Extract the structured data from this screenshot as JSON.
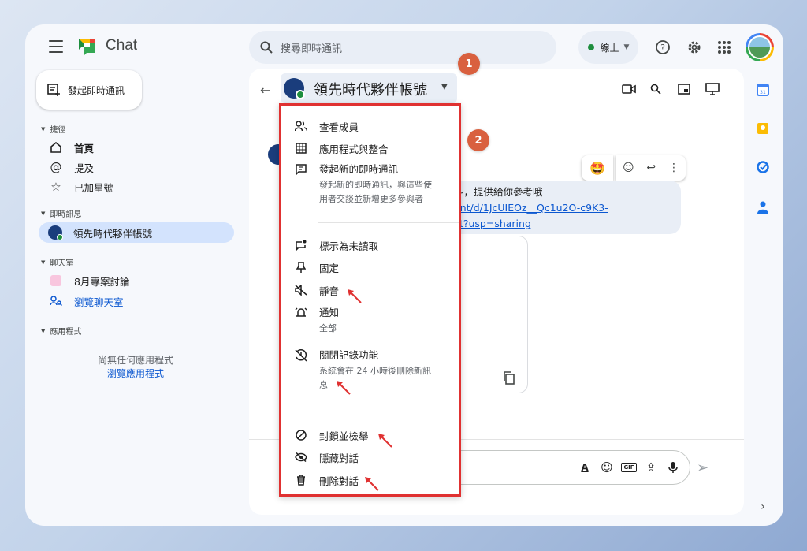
{
  "header": {
    "app_title": "Chat",
    "search_placeholder": "搜尋即時通訊",
    "status": "線上"
  },
  "sidebar": {
    "new_chat": "發起即時通訊",
    "shortcuts": {
      "title": "捷徑",
      "items": [
        "首頁",
        "提及",
        "已加星號"
      ]
    },
    "direct_messages": {
      "title": "即時訊息",
      "items": [
        "領先時代夥伴帳號"
      ]
    },
    "spaces": {
      "title": "聊天室",
      "items": [
        "8月專案討論",
        "瀏覽聊天室"
      ]
    },
    "apps": {
      "title": "應用程式",
      "empty_text": "尚無任何應用程式",
      "browse_link": "瀏覽應用程式"
    }
  },
  "conversation": {
    "title": "領先時代夥伴帳號",
    "message_line1": "斗，提供給你參考哦",
    "message_link1": "ent/d/1JcUIEOz__Qc1u2O-c9K3-",
    "message_link2": "lit?usp=sharing",
    "reaction_emoji": "🤩"
  },
  "menu": {
    "items": [
      {
        "label": "查看成員",
        "icon": "people-icon"
      },
      {
        "label": "應用程式與整合",
        "icon": "apps-grid-icon"
      },
      {
        "label": "發起新的即時通訊",
        "sub1": "發起新的即時通訊，與這些使",
        "sub2": "用者交談並新增更多參與者",
        "icon": "new-chat-icon"
      },
      {
        "label": "標示為未讀取",
        "icon": "mark-unread-icon"
      },
      {
        "label": "固定",
        "icon": "pin-icon"
      },
      {
        "label": "靜音",
        "icon": "mute-icon"
      },
      {
        "label": "通知",
        "sub1": "全部",
        "icon": "bell-icon"
      },
      {
        "label": "關閉記錄功能",
        "sub1": "系統會在 24 小時後刪除新訊",
        "sub2": "息",
        "icon": "history-off-icon"
      },
      {
        "label": "封鎖並檢舉",
        "icon": "block-icon"
      },
      {
        "label": "隱藏對話",
        "icon": "hide-icon"
      },
      {
        "label": "刪除對話",
        "icon": "trash-icon"
      }
    ]
  },
  "badges": [
    "1",
    "2"
  ],
  "colors": {
    "highlight_border": "#e03131",
    "badge": "#d9603f",
    "active_nav": "#d3e3fd",
    "link": "#0b57d0",
    "online": "#1e8e3e"
  }
}
